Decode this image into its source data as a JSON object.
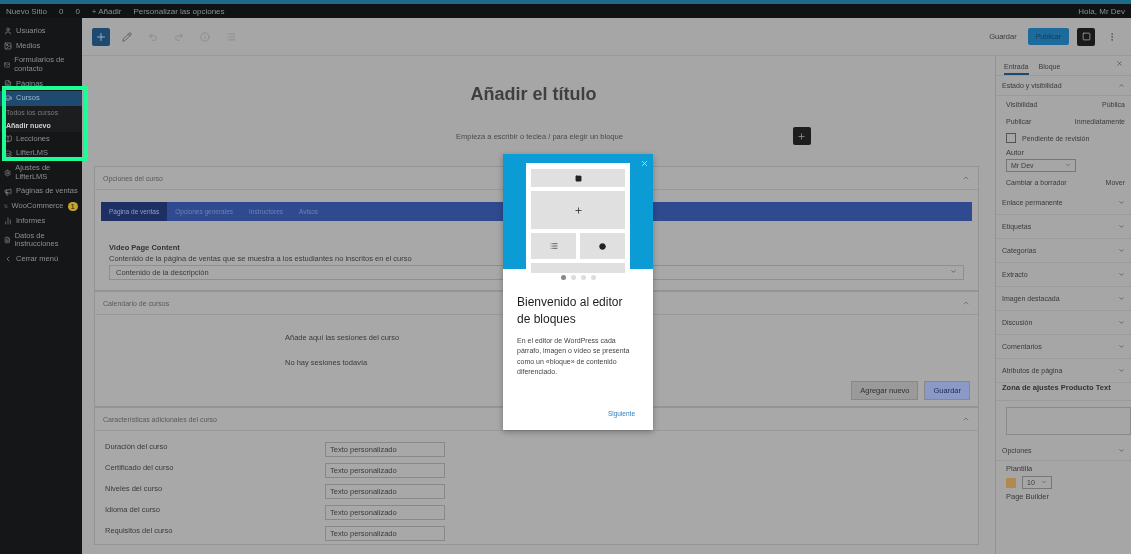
{
  "admin_bar": {
    "items": [
      "Nuevo Sitio",
      "0",
      "0",
      "+ Añadir",
      "Personalizar las opciones"
    ],
    "greeting": "Hola, Mr Dev"
  },
  "sidebar": {
    "items": [
      {
        "label": "Usuarios",
        "selected": false
      },
      {
        "label": "Medios",
        "selected": false
      },
      {
        "label": "Formularios de contacto",
        "selected": false
      },
      {
        "label": "Páginas",
        "selected": false
      },
      {
        "label": "Cursos",
        "selected": true,
        "children": [
          {
            "label": "Todos los cursos",
            "selected": false
          },
          {
            "label": "Añadir nuevo",
            "selected": true
          }
        ]
      },
      {
        "label": "Lecciones",
        "selected": false
      },
      {
        "label": "LifterLMS",
        "selected": false
      },
      {
        "label": "Ajustes de LifterLMS",
        "selected": false
      },
      {
        "label": "Páginas de ventas",
        "selected": false
      },
      {
        "label": "WooCommerce",
        "selected": false,
        "badge": "1"
      },
      {
        "label": "Informes",
        "selected": false
      },
      {
        "label": "Datos de instrucciones",
        "selected": false
      },
      {
        "label": "Cerrar menú",
        "selected": false
      }
    ]
  },
  "toolbar": {
    "save": "Guardar",
    "publish": "Publicar"
  },
  "editor": {
    "title_placeholder": "Añadir el título",
    "block_placeholder": "Empieza a escribir o teclea / para elegir un bloque"
  },
  "course_options": {
    "title": "Opciones del curso",
    "tabs": [
      {
        "label": "Página de ventas",
        "selected": true
      },
      {
        "label": "Opciones generales",
        "selected": false
      },
      {
        "label": "Instructores",
        "selected": false
      },
      {
        "label": "Avisos",
        "selected": false
      }
    ],
    "field_label": "Video Page Content",
    "field_help": "Contenido de la página de ventas que se muestra a los estudiantes no inscritos en el curso",
    "select_value": "Contenido de la descripción"
  },
  "schedule": {
    "title": "Calendario de cursos",
    "lines": [
      "Añade aquí las sesiones del curso",
      "No hay sesiones todavía"
    ],
    "buttons": [
      "Agregar nuevo",
      "Guardar"
    ]
  },
  "extra": {
    "title": "Características adicionales del curso",
    "rows": [
      {
        "label": "Duración del curso",
        "placeholder": "Texto personalizado"
      },
      {
        "label": "Certificado del curso",
        "placeholder": "Texto personalizado"
      },
      {
        "label": "Niveles del curso",
        "placeholder": "Texto personalizado"
      },
      {
        "label": "Idioma del curso",
        "placeholder": "Texto personalizado"
      },
      {
        "label": "Requisitos del curso",
        "placeholder": "Texto personalizado"
      }
    ]
  },
  "settings": {
    "tabs": [
      {
        "label": "Entrada",
        "selected": true
      },
      {
        "label": "Bloque",
        "selected": false
      }
    ],
    "status_title": "Estado y visibilidad",
    "visibility_label": "Visibilidad",
    "visibility_value": "Pública",
    "publish_label": "Publicar",
    "publish_value": "Inmediatamente",
    "pending": {
      "label": "Pendiente de revisión",
      "checked": false
    },
    "author_label": "Autor",
    "author_value": "Mr Dev",
    "draft": "Cambiar a borrador",
    "trash": "Mover",
    "sections": [
      {
        "title": "Enlace permanente",
        "expanded": false
      },
      {
        "title": "Etiquetas",
        "expanded": false
      },
      {
        "title": "Categorías",
        "expanded": false
      },
      {
        "title": "Extracto",
        "expanded": false
      },
      {
        "title": "Imagen destacada",
        "expanded": false
      },
      {
        "title": "Discusión",
        "expanded": false
      },
      {
        "title": "Comentarios",
        "expanded": false
      },
      {
        "title": "Atributos de página",
        "expanded": false
      }
    ],
    "custom_title": "Zona de ajustes Producto Text",
    "options_title": "Opciones",
    "template_label": "Plantilla",
    "size_value": "10",
    "page_builder": "Page Builder"
  },
  "welcome": {
    "title": "Bienvenido al editor de bloques",
    "body": "En el editor de WordPress cada párrafo, imagen o vídeo se presenta como un «bloque» de contenido diferenciado.",
    "pages": [
      {
        "selected": true
      },
      {
        "selected": false
      },
      {
        "selected": false
      },
      {
        "selected": false
      }
    ],
    "next": "Siguiente"
  }
}
